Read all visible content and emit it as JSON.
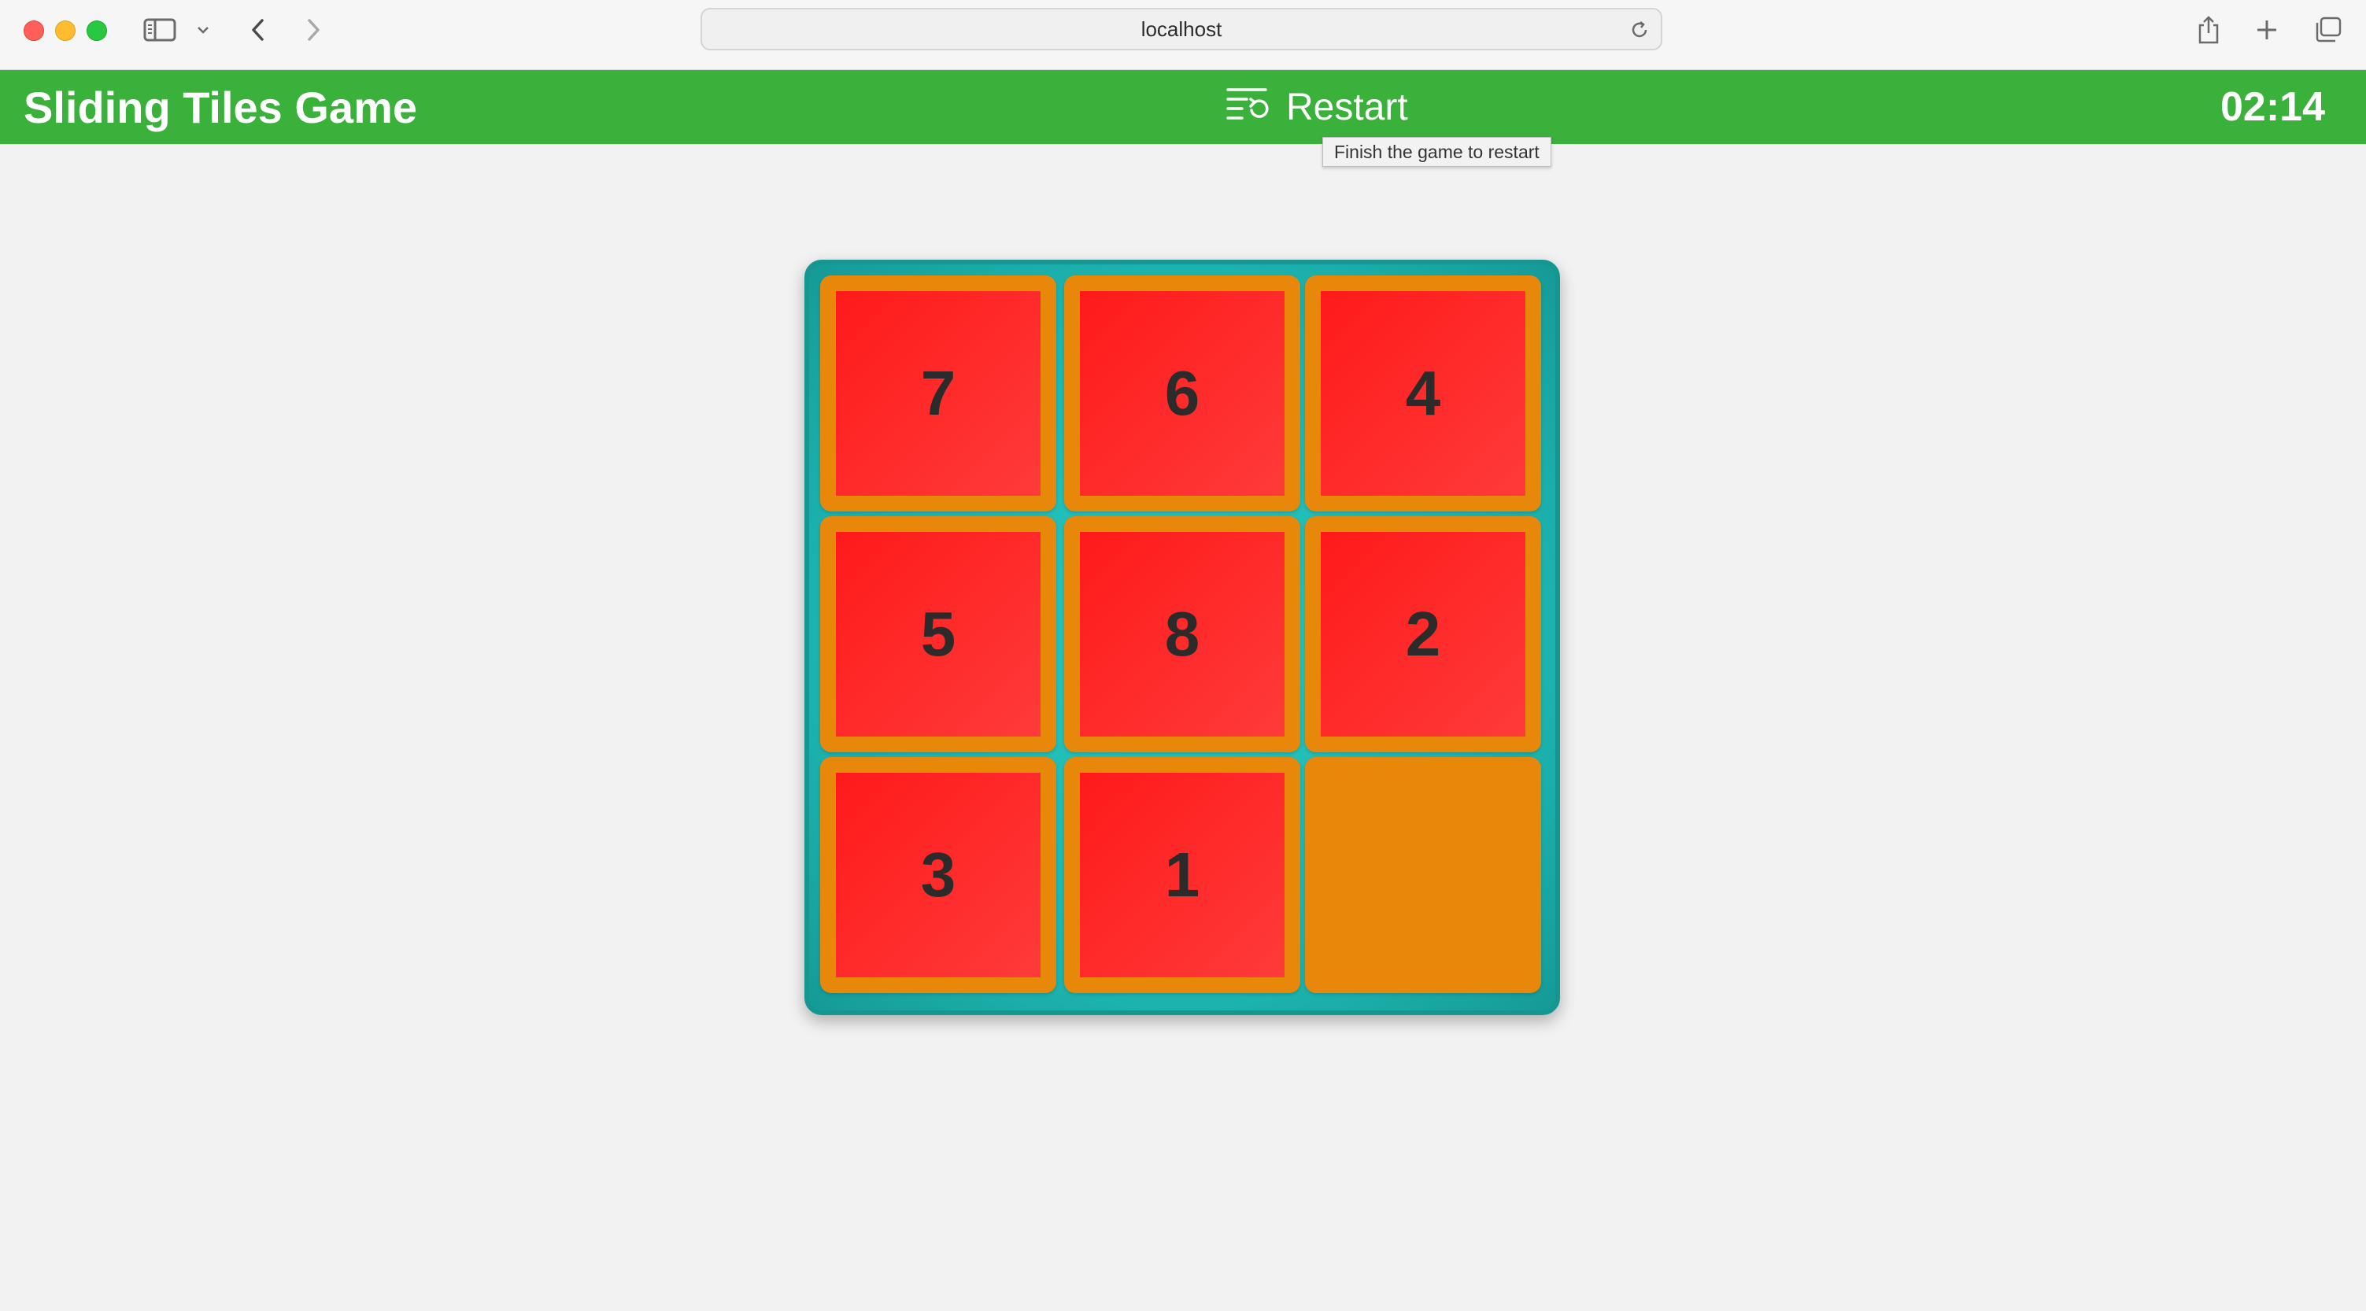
{
  "browser": {
    "url": "localhost"
  },
  "header": {
    "title": "Sliding Tiles Game",
    "restart_label": "Restart",
    "timer": "02:14"
  },
  "tooltip": {
    "text": "Finish the game to restart"
  },
  "board": {
    "tiles": [
      "7",
      "6",
      "4",
      "5",
      "8",
      "2",
      "3",
      "1"
    ]
  },
  "colors": {
    "header_bg": "#39b13a",
    "board_bg": "#1cb2ae",
    "tile_border": "#e8880b",
    "tile_face": "#ff2a2a"
  },
  "icons": {
    "restart": "list-restart-icon"
  }
}
